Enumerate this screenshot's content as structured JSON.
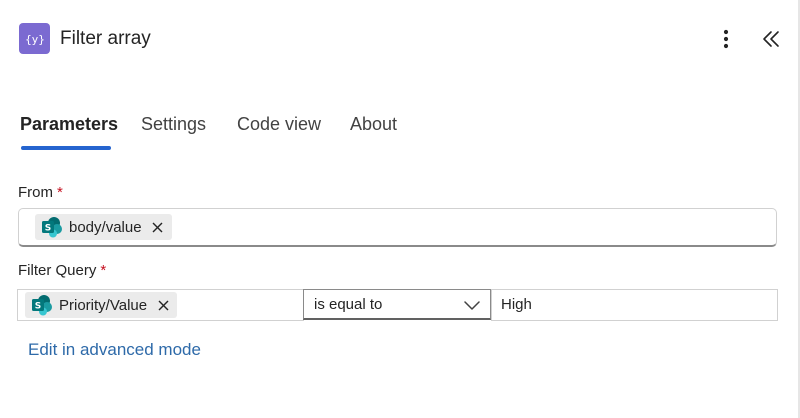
{
  "header": {
    "title": "Filter array",
    "action_icon": "data-operation-icon",
    "action_icon_color": "#7b6ad1",
    "more_icon": "more-vertical-icon",
    "collapse_icon": "double-chevron-left-icon"
  },
  "tabs": [
    {
      "label": "Parameters",
      "active": true
    },
    {
      "label": "Settings",
      "active": false
    },
    {
      "label": "Code view",
      "active": false
    },
    {
      "label": "About",
      "active": false
    }
  ],
  "accent_color": "#2564cf",
  "from": {
    "label": "From",
    "required_mark": "*",
    "token": {
      "label": "body/value",
      "icon": "sharepoint-icon"
    }
  },
  "filter_query": {
    "label": "Filter Query",
    "required_mark": "*",
    "left_token": {
      "label": "Priority/Value",
      "icon": "sharepoint-icon"
    },
    "operator": "is equal to",
    "value": "High"
  },
  "advanced_link": "Edit in advanced mode"
}
